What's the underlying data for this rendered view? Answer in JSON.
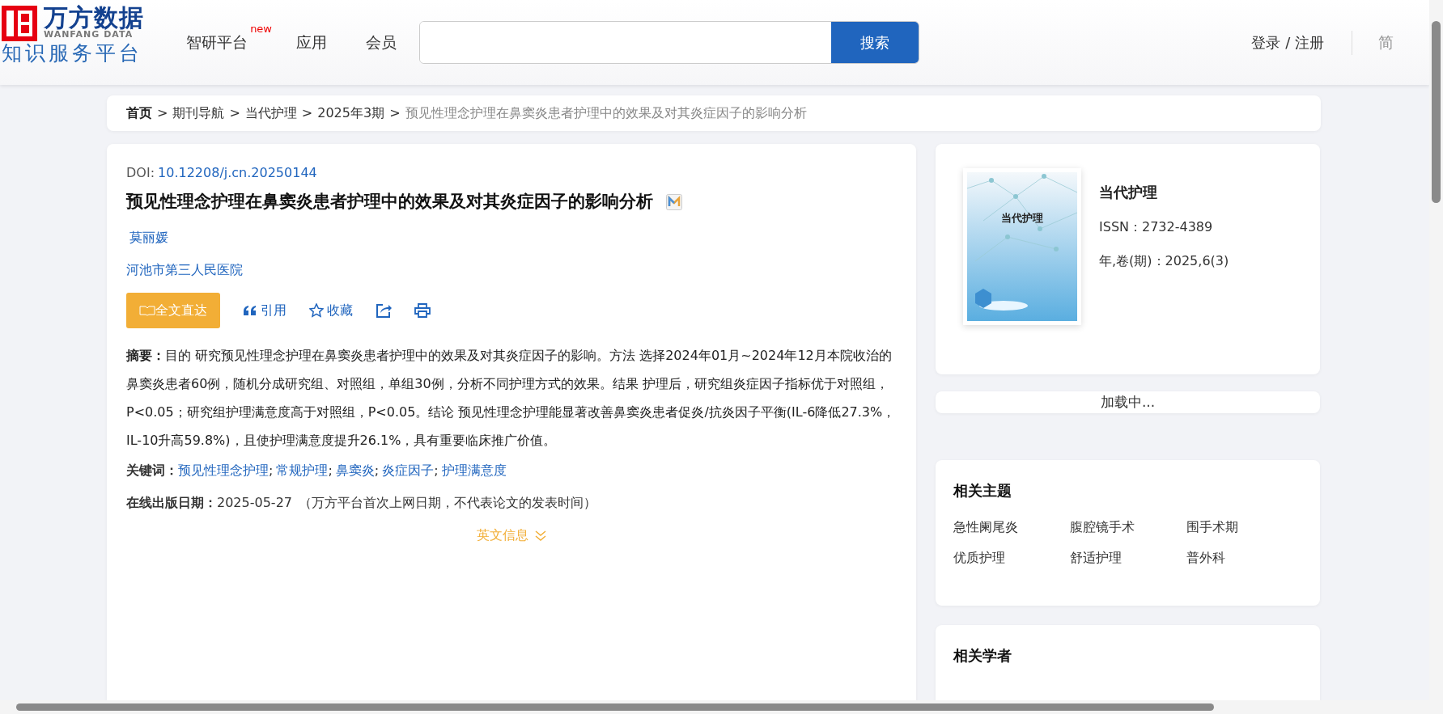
{
  "header": {
    "logo": {
      "name": "万方数据",
      "name_en": "WANFANG DATA",
      "subtitle": "知识服务平台"
    },
    "nav": [
      {
        "label": "智研平台",
        "badge": "new"
      },
      {
        "label": "应用"
      },
      {
        "label": "会员"
      }
    ],
    "search": {
      "button": "搜索"
    },
    "login": "登录 / 注册",
    "languages": [
      {
        "label": "简",
        "selected": true
      }
    ]
  },
  "breadcrumb_separator": ">",
  "breadcrumb": [
    {
      "label": "首页",
      "kind": "home"
    },
    {
      "label": "期刊导航",
      "kind": "link"
    },
    {
      "label": "当代护理",
      "kind": "link"
    },
    {
      "label": "2025年3期",
      "kind": "link"
    },
    {
      "label": "预见性理念护理在鼻窦炎患者护理中的效果及对其炎症因子的影响分析",
      "kind": "current"
    }
  ],
  "article": {
    "doi_label": "DOI:",
    "doi": "10.12208/j.cn.20250144",
    "title": "预见性理念护理在鼻窦炎患者护理中的效果及对其炎症因子的影响分析",
    "authors": [
      "莫丽媛"
    ],
    "affiliation": "河池市第三人民医院",
    "fulltext_button": "全文直达",
    "actions": [
      {
        "kind": "cite",
        "label": "引用"
      },
      {
        "kind": "favorite",
        "label": "收藏"
      },
      {
        "kind": "share"
      },
      {
        "kind": "print"
      }
    ],
    "abstract_label": "摘要：",
    "abstract": "目的 研究预见性理念护理在鼻窦炎患者护理中的效果及对其炎症因子的影响。方法 选择2024年01月~2024年12月本院收治的鼻窦炎患者60例，随机分成研究组、对照组，单组30例，分析不同护理方式的效果。结果 护理后，研究组炎症因子指标优于对照组，P<0.05；研究组护理满意度高于对照组，P<0.05。结论 预见性理念护理能显著改善鼻窦炎患者促炎/抗炎因子平衡(IL-6降低27.3%，IL-10升高59.8%)，且使护理满意度提升26.1%，具有重要临床推广价值。",
    "keywords_label": "关键词：",
    "keyword_separator": ";",
    "keywords": [
      "预见性理念护理",
      "常规护理",
      "鼻窦炎",
      "炎症因子",
      "护理满意度"
    ],
    "date_label": "在线出版日期：",
    "date": "2025-05-27",
    "date_note": "（万方平台首次上网日期，不代表论文的发表时间）",
    "english_toggle": "英文信息",
    "english_expanded": false
  },
  "journal": {
    "cover_title": "当代护理",
    "name": "当代护理",
    "issn": "ISSN：2732-4389",
    "volume": "年,卷(期)：2025,6(3)"
  },
  "loading": "加载中...",
  "topics": {
    "title": "相关主题",
    "items": [
      "急性阑尾炎",
      "腹腔镜手术",
      "围手术期",
      "优质护理",
      "舒适护理",
      "普外科"
    ]
  },
  "scholars": {
    "title": "相关学者"
  }
}
